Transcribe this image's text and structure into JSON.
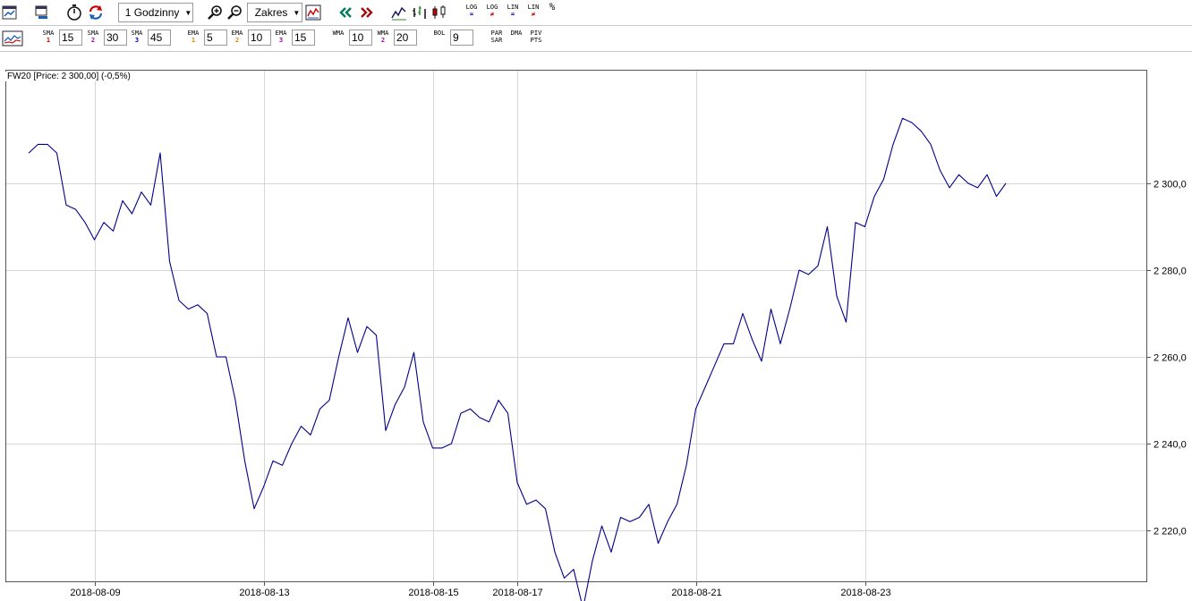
{
  "toolbar1": {
    "interval_label": "1 Godzinny",
    "range_label": "Zakres",
    "icons": [
      "chart-window-icon",
      "new-window-icon",
      "timer-icon",
      "refresh-icon",
      "zoom-in-icon",
      "zoom-out-icon",
      "fit-range-icon",
      "scroll-back-icon",
      "scroll-forward-icon",
      "line-chart-icon",
      "ohlc-chart-icon",
      "candle-chart-icon"
    ],
    "scales": [
      {
        "top": "LOG",
        "bottom": "="
      },
      {
        "top": "LOG",
        "bottom": "≠"
      },
      {
        "top": "LIN",
        "bottom": "="
      },
      {
        "top": "LIN",
        "bottom": "≠"
      },
      {
        "top": "%",
        "bottom": ""
      }
    ]
  },
  "toolbar2": {
    "sma": [
      {
        "label": "SMA",
        "n": "1",
        "value": "15"
      },
      {
        "label": "SMA",
        "n": "2",
        "value": "30"
      },
      {
        "label": "SMA",
        "n": "3",
        "value": "45"
      }
    ],
    "ema": [
      {
        "label": "EMA",
        "n": "1",
        "value": "5"
      },
      {
        "label": "EMA",
        "n": "2",
        "value": "10"
      },
      {
        "label": "EMA",
        "n": "3",
        "value": "15"
      }
    ],
    "wma": [
      {
        "label": "WMA",
        "n": "",
        "value": "10"
      },
      {
        "label": "WMA",
        "n": "2",
        "value": "20"
      }
    ],
    "bol": {
      "label": "BOL",
      "value": "9"
    },
    "extra": [
      {
        "top": "PAR",
        "bottom": "SAR"
      },
      {
        "top": "DMA",
        "bottom": ""
      },
      {
        "top": "PIV",
        "bottom": "PTS"
      }
    ]
  },
  "chart": {
    "info": "FW20 [Price: 2 300,00] (-0,5%)"
  },
  "colors": {
    "line": "#00008b",
    "grid": "#d6d6d6",
    "sub_blue": "#0000cc",
    "sub_red": "#cc0000",
    "sub_orange": "#e08000",
    "sub_purple": "#a000a0"
  },
  "chart_data": {
    "type": "line",
    "ylim": [
      2200,
      2320
    ],
    "y_ticks": [
      2220,
      2240,
      2260,
      2280,
      2300
    ],
    "y_tick_labels": [
      "2 220,0",
      "2 240,0",
      "2 260,0",
      "2 280,0",
      "2 300,0"
    ],
    "x_ticks": [
      {
        "i": 7,
        "label": "2018-08-09"
      },
      {
        "i": 25,
        "label": "2018-08-13"
      },
      {
        "i": 43,
        "label": "2018-08-15"
      },
      {
        "i": 52,
        "label": "2018-08-17"
      },
      {
        "i": 71,
        "label": "2018-08-21"
      },
      {
        "i": 89,
        "label": "2018-08-23"
      }
    ],
    "series": [
      {
        "values": [
          2307,
          2309,
          2309,
          2307,
          2295,
          2294,
          2291,
          2287,
          2291,
          2289,
          2296,
          2293,
          2298,
          2295,
          2307,
          2282,
          2273,
          2271,
          2272,
          2270,
          2260,
          2260,
          2250,
          2236,
          2225,
          2230,
          2236,
          2235,
          2240,
          2244,
          2242,
          2248,
          2250,
          2260,
          2269,
          2261,
          2267,
          2265,
          2243,
          2249,
          2253,
          2261,
          2245,
          2239,
          2239,
          2240,
          2247,
          2248,
          2246,
          2245,
          2250,
          2247,
          2231,
          2226,
          2227,
          2225,
          2215,
          2209,
          2211,
          2202,
          2213,
          2221,
          2215,
          2223,
          2222,
          2223,
          2226,
          2217,
          2222,
          2226,
          2235,
          2248,
          2253,
          2258,
          2263,
          2263,
          2270,
          2264,
          2259,
          2271,
          2263,
          2271,
          2280,
          2279,
          2281,
          2290,
          2274,
          2268,
          2291,
          2290,
          2297,
          2301,
          2309,
          2315,
          2314,
          2312,
          2309,
          2303,
          2299,
          2302,
          2300,
          2299,
          2302,
          2297,
          2300
        ]
      }
    ]
  }
}
